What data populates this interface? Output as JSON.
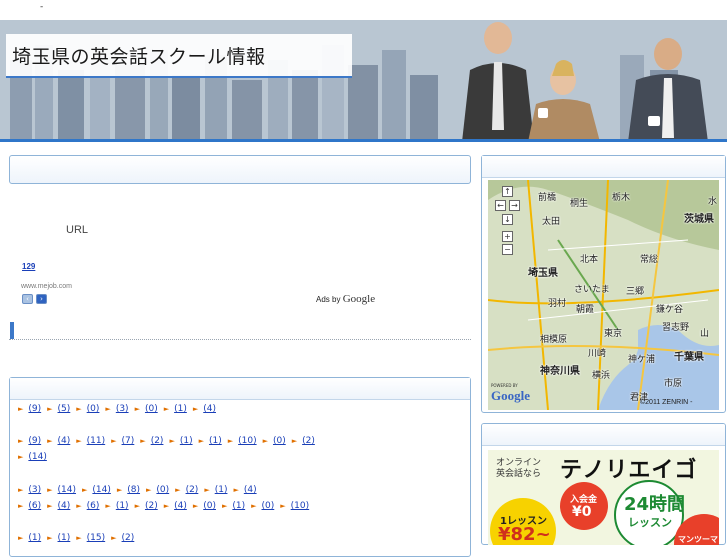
{
  "topbar": {
    "mark": "-"
  },
  "header": {
    "title": "埼玉県の英会話スクール情報"
  },
  "ad": {
    "url_text": "URL",
    "link_text": "129",
    "domain": "www.mejob.com",
    "prev_icon": "chevron-left-icon",
    "next_icon": "chevron-right-icon",
    "ads_by": "Ads by",
    "ads_brand": "Google"
  },
  "link_rows": [
    [
      "(9)",
      "(5)",
      "(0)",
      "(3)",
      "(0)",
      "(1)",
      "(4)"
    ],
    [
      "(9)",
      "(4)",
      "(11)",
      "(7)",
      "(2)",
      "(1)",
      "(1)",
      "(10)",
      "(0)",
      "(2)"
    ],
    [
      "(14)"
    ],
    [
      "(3)",
      "(14)",
      "(14)",
      "(8)",
      "(0)",
      "(2)",
      "(1)",
      "(4)"
    ],
    [
      "(6)",
      "(4)",
      "(6)",
      "(1)",
      "(2)",
      "(4)",
      "(0)",
      "(1)",
      "(0)",
      "(10)"
    ],
    [
      "(1)",
      "(1)",
      "(15)",
      "(2)"
    ]
  ],
  "map": {
    "labels": [
      "前橋",
      "桐生",
      "栃木",
      "太田",
      "水",
      "茨城県",
      "埼玉県",
      "北本",
      "常総",
      "さいたま",
      "三郷",
      "羽村",
      "朝霞",
      "鎌ケ谷",
      "相模原",
      "東京",
      "習志野",
      "山",
      "川崎",
      "神ケ浦",
      "千葉県",
      "神奈川県",
      "横浜",
      "市原",
      "君津"
    ],
    "powered": "POWERED BY",
    "brand": "Google",
    "copyright": "©2011 ZENRIN -"
  },
  "banner": {
    "line1": "オンライン",
    "line2": "英会話なら",
    "brand": "テノリエイゴ",
    "lesson_label": "1レッスン",
    "lesson_price": "¥82~",
    "fee_label": "入会金",
    "fee_value": "¥0",
    "hours": "24時間",
    "hours_label": "レッスン",
    "mantoman": "マンツーマン"
  }
}
